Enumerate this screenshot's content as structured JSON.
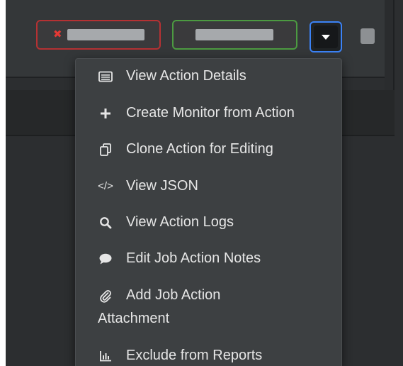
{
  "status_pills": {
    "failed_marker": "✖"
  },
  "menu": {
    "items": [
      {
        "label": "View Action Details",
        "icon": "list-details-icon"
      },
      {
        "label": "Create Monitor from Action",
        "icon": "plus-icon"
      },
      {
        "label": "Clone Action for Editing",
        "icon": "clone-icon"
      },
      {
        "label": "View JSON",
        "icon": "code-icon",
        "icon_text": "</>"
      },
      {
        "label": "View Action Logs",
        "icon": "search-icon"
      },
      {
        "label": "Edit Job Action Notes",
        "icon": "comment-icon"
      },
      {
        "label_line1": "Add Job Action",
        "label_line2": "Attachment",
        "icon": "paperclip-icon"
      },
      {
        "label": "Exclude from Reports",
        "icon": "bar-chart-icon"
      }
    ]
  },
  "colors": {
    "failed_border": "#b53133",
    "success_border": "#4c9a41",
    "focus_border": "#3b82f6",
    "menu_bg": "#3d4042"
  }
}
